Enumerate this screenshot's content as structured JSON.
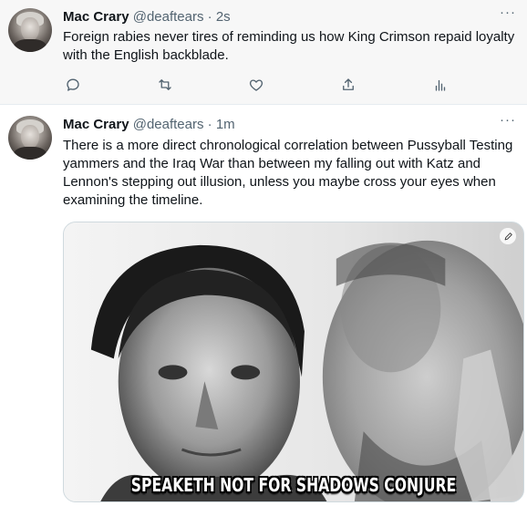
{
  "tweets": [
    {
      "author": {
        "name": "Mac Crary",
        "handle": "@deaftears",
        "avatar_icon": "user-avatar-photo"
      },
      "separator": "·",
      "time": "2s",
      "more_label": "···",
      "text": "Foreign rabies never tires of reminding us how King Crimson repaid loyalty with the English backblade.",
      "actions": [
        {
          "name": "reply",
          "icon": "reply-icon"
        },
        {
          "name": "retweet",
          "icon": "retweet-icon"
        },
        {
          "name": "like",
          "icon": "like-icon"
        },
        {
          "name": "share",
          "icon": "share-icon"
        },
        {
          "name": "analytics",
          "icon": "analytics-icon"
        }
      ]
    },
    {
      "author": {
        "name": "Mac Crary",
        "handle": "@deaftears",
        "avatar_icon": "user-avatar-photo"
      },
      "separator": "·",
      "time": "1m",
      "more_label": "···",
      "text": "There is a more direct chronological correlation between Pussyball Testing yammers and the Iraq War than between my falling out with Katz and Lennon's stepping out illusion, unless you maybe cross your eyes when examining the timeline.",
      "media": {
        "caption": "SPEAKETH NOT FOR SHADOWS CONJURE",
        "edit_icon": "pencil-icon"
      }
    }
  ],
  "colors": {
    "text": "#0f1419",
    "secondary": "#536471",
    "highlight_bg": "#f7f7f7",
    "border": "#cfd9de"
  }
}
